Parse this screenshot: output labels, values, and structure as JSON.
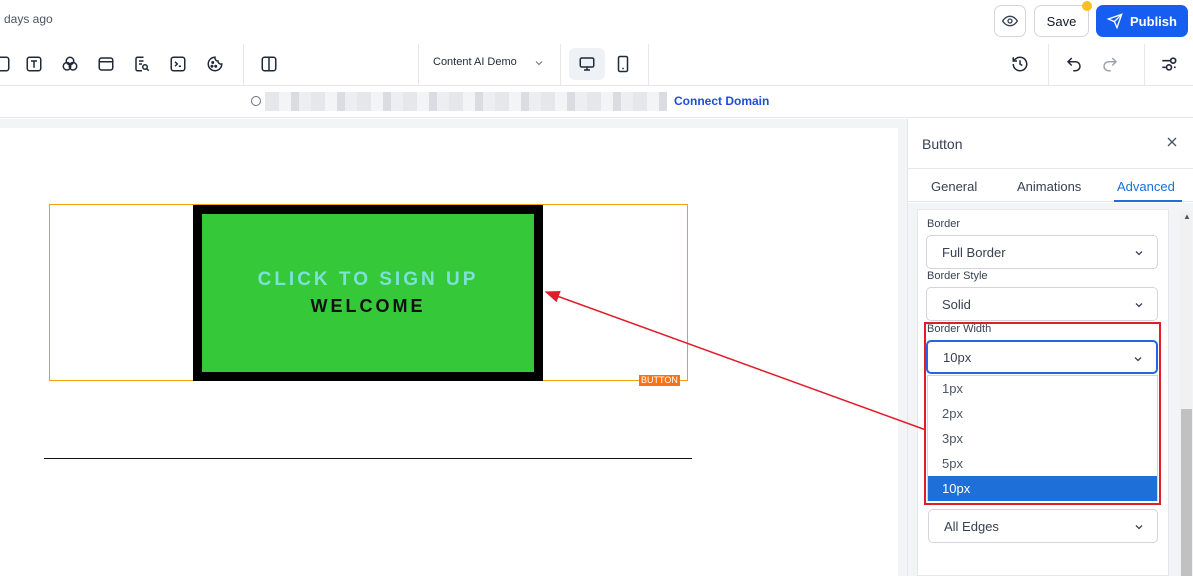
{
  "header": {
    "saved_text": "days ago",
    "save_label": "Save",
    "publish_label": "Publish"
  },
  "toolbar": {
    "icons": [
      "image-icon",
      "text-icon",
      "shapes-icon",
      "container-icon",
      "form-search-icon",
      "code-icon",
      "cookie-icon",
      "columns-icon"
    ],
    "demo_select_value": "Content AI Demo",
    "right_icons": [
      "history-icon",
      "undo-icon",
      "redo-icon",
      "settings-sliders-icon"
    ]
  },
  "url_bar": {
    "connect_domain_label": "Connect Domain"
  },
  "canvas": {
    "button_line1": "CLICK TO SIGN UP",
    "button_line2": "WELCOME",
    "element_tag": "BUTTON",
    "button_color": "#35c93a",
    "button_border_color": "#000000"
  },
  "panel": {
    "title": "Button",
    "tabs": [
      "General",
      "Animations",
      "Advanced"
    ],
    "active_tab": "Advanced",
    "border_label": "Border",
    "border_value": "Full Border",
    "border_style_label": "Border Style",
    "border_style_value": "Solid",
    "border_width_label": "Border Width",
    "border_width_value": "10px",
    "border_width_options": [
      "1px",
      "2px",
      "3px",
      "5px",
      "10px"
    ],
    "border_width_selected": "10px",
    "radius_edge_value": "All Edges",
    "highlight_color": "#e11d2a",
    "accent_color": "#155eef"
  }
}
